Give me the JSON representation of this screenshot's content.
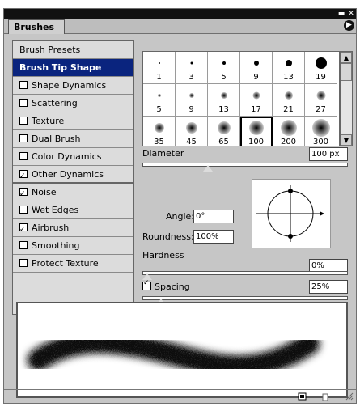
{
  "panel": {
    "tab_label": "Brushes",
    "menu_icon": "flyout-menu-icon"
  },
  "left_list": [
    {
      "label": "Brush Presets",
      "type": "plain"
    },
    {
      "label": "Brush Tip Shape",
      "type": "selected"
    },
    {
      "label": "Shape Dynamics",
      "type": "check",
      "checked": false
    },
    {
      "label": "Scattering",
      "type": "check",
      "checked": false
    },
    {
      "label": "Texture",
      "type": "check",
      "checked": false
    },
    {
      "label": "Dual Brush",
      "type": "check",
      "checked": false
    },
    {
      "label": "Color Dynamics",
      "type": "check",
      "checked": false
    },
    {
      "label": "Other Dynamics",
      "type": "check",
      "checked": true
    },
    {
      "label": "Noise",
      "type": "check",
      "checked": true
    },
    {
      "label": "Wet Edges",
      "type": "check",
      "checked": false
    },
    {
      "label": "Airbrush",
      "type": "check",
      "checked": true
    },
    {
      "label": "Smoothing",
      "type": "check",
      "checked": false
    },
    {
      "label": "Protect Texture",
      "type": "check",
      "checked": false
    }
  ],
  "brush_grid": [
    "1",
    "3",
    "5",
    "9",
    "13",
    "19",
    "5",
    "9",
    "13",
    "17",
    "21",
    "27",
    "35",
    "45",
    "65",
    "100",
    "200",
    "300"
  ],
  "selected_brush": "100",
  "diameter": {
    "label": "Diameter",
    "value": "100 px",
    "level": 0.31
  },
  "angle": {
    "label": "Angle:",
    "value": "0°"
  },
  "roundness": {
    "label": "Roundness:",
    "value": "100%"
  },
  "hardness": {
    "label": "Hardness",
    "value": "0%",
    "level": 0
  },
  "spacing": {
    "label": "Spacing",
    "value": "25%",
    "checked": true,
    "level": 0.07
  }
}
